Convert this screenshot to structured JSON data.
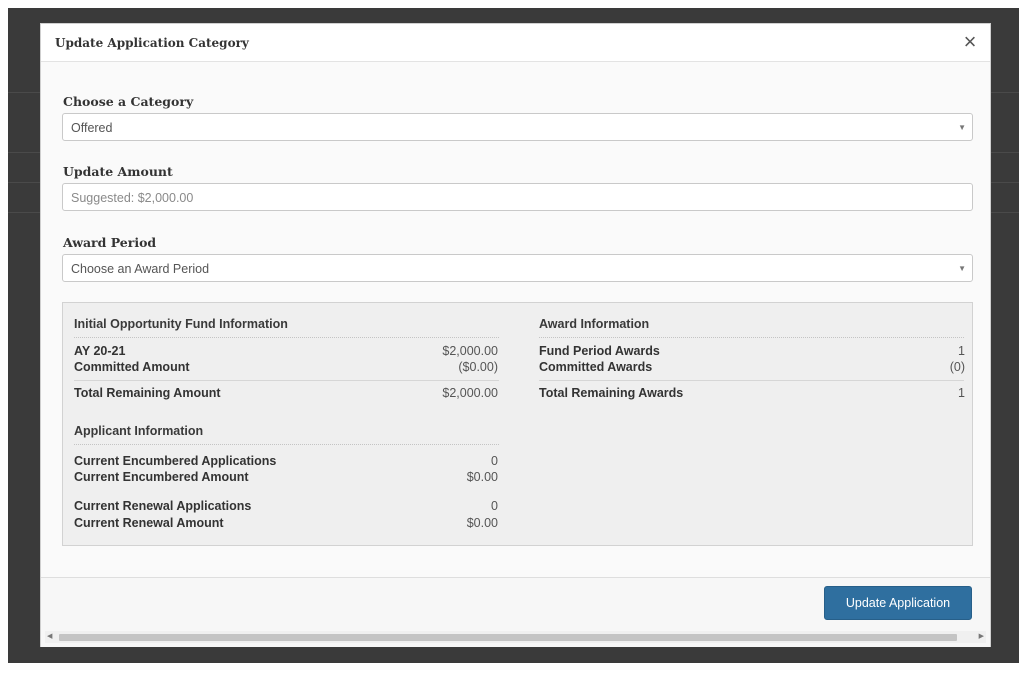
{
  "modal": {
    "title": "Update Application Category",
    "close_symbol": "×"
  },
  "form": {
    "category": {
      "label": "Choose a Category",
      "selected": "Offered"
    },
    "amount": {
      "label": "Update Amount",
      "placeholder": "Suggested: $2,000.00"
    },
    "award_period": {
      "label": "Award Period",
      "selected": "Choose an Award Period"
    }
  },
  "fund_info": {
    "heading": "Initial Opportunity Fund Information",
    "rows": [
      {
        "label": "AY 20-21",
        "value": "$2,000.00"
      },
      {
        "label": "Committed Amount",
        "value": "($0.00)"
      }
    ],
    "total": {
      "label": "Total Remaining Amount",
      "value": "$2,000.00"
    }
  },
  "applicant_info": {
    "heading": "Applicant Information",
    "rows": [
      {
        "label": "Current Encumbered Applications",
        "value": "0"
      },
      {
        "label": "Current Encumbered Amount",
        "value": "$0.00"
      },
      {
        "label": "Current Renewal Applications",
        "value": "0"
      },
      {
        "label": "Current Renewal Amount",
        "value": "$0.00"
      }
    ]
  },
  "award_info": {
    "heading": "Award Information",
    "rows": [
      {
        "label": "Fund Period Awards",
        "value": "1"
      },
      {
        "label": "Committed Awards",
        "value": "(0)"
      }
    ],
    "total": {
      "label": "Total Remaining Awards",
      "value": "1"
    }
  },
  "footer": {
    "update_button": "Update Application"
  },
  "icons": {
    "close": "close-icon",
    "dropdown": "chevron-down-icon",
    "scroll_left": "chevron-left-icon",
    "scroll_right": "chevron-right-icon"
  },
  "colors": {
    "primary_button": "#2f6f9f",
    "backdrop": "#3a3a3a"
  }
}
